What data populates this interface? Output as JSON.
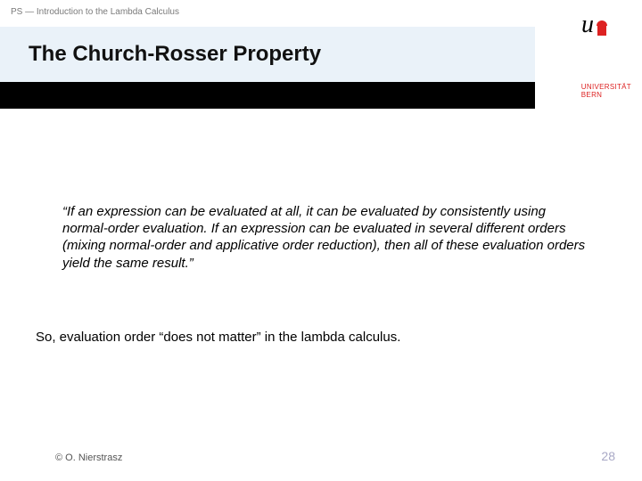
{
  "breadcrumb": "PS — Introduction to the Lambda Calculus",
  "title": "The Church-Rosser Property",
  "university": {
    "line1": "UNIVERSITÄT",
    "line2": "BERN",
    "glyph": "u"
  },
  "quote": "“If an expression can be evaluated at all, it can be evaluated by consistently using normal-order evaluation. If an expression can be evaluated in several different orders (mixing normal-order and applicative order reduction), then all of these evaluation orders yield the same result.”",
  "summary": "So, evaluation order “does not matter” in the lambda calculus.",
  "footer": {
    "copyright": "© O. Nierstrasz",
    "page": "28"
  }
}
